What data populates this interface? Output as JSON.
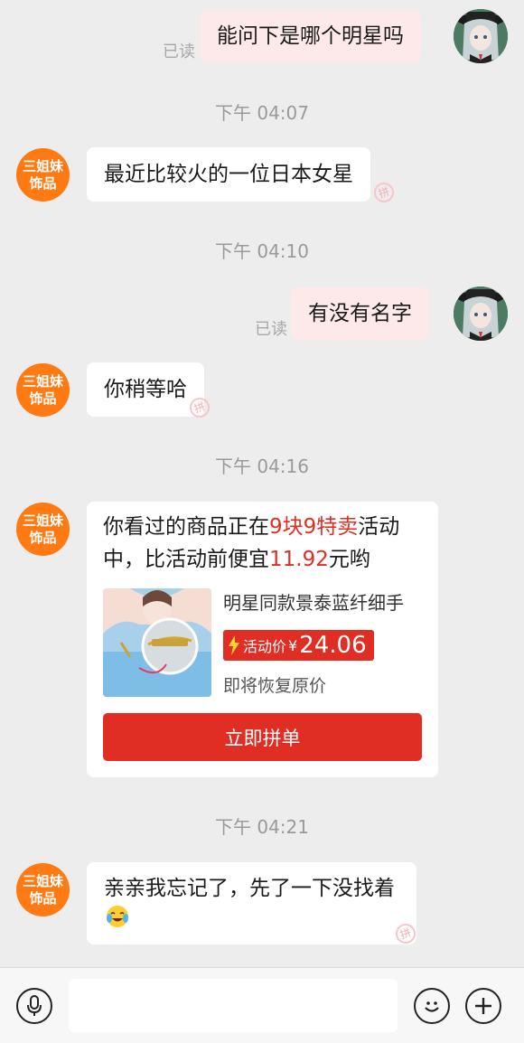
{
  "messages": {
    "m1": {
      "text": "能问下是哪个明星吗",
      "read": "已读"
    },
    "t1": "下午 04:07",
    "m2": {
      "text": "最近比较火的一位日本女星"
    },
    "t2": "下午 04:10",
    "m3": {
      "text": "有没有名字",
      "read": "已读"
    },
    "m4": {
      "text": "你稍等哈"
    },
    "t3": "下午 04:16",
    "card": {
      "text_a": "你看过的商品正在",
      "text_highlight": "9块9特卖",
      "text_b": "活动中，比活动前便宜",
      "text_amount": "11.92",
      "text_c": "元哟",
      "product_name": "明星同款景泰蓝纤细手",
      "price_label": "活动价",
      "price_currency": "¥",
      "price_value": "24.06",
      "restore_text": "即将恢复原价",
      "button_label": "立即拼单"
    },
    "t4": "下午 04:21",
    "m5": {
      "text": "亲亲我忘记了，先了一下没找着"
    }
  },
  "shop_avatar": {
    "line1": "三姐妹",
    "line2": "饰品"
  },
  "watermark": "拼",
  "colors": {
    "accent": "#e02e24",
    "shop_avatar": "#ff7a12",
    "outgoing_bubble": "#fde9e9"
  },
  "icons": {
    "voice": "microphone-icon",
    "emoji": "smiley-icon",
    "more": "plus-icon"
  }
}
